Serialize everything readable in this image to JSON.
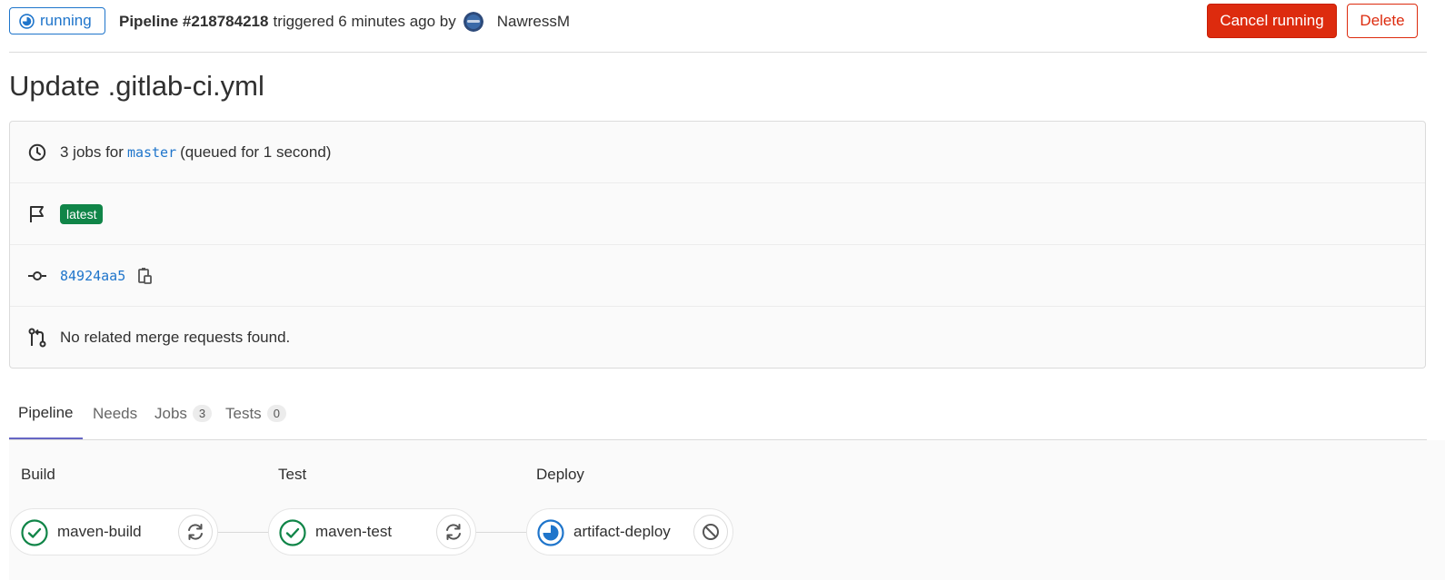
{
  "header": {
    "status_label": "running",
    "pipeline_id": "Pipeline #218784218",
    "triggered_text": "triggered 6 minutes ago by",
    "author": "NawressM",
    "cancel_label": "Cancel running",
    "delete_label": "Delete"
  },
  "title": "Update .gitlab-ci.yml",
  "info": {
    "jobs_prefix": "3 jobs for",
    "branch": "master",
    "queued": "(queued for 1 second)",
    "tag": "latest",
    "commit_sha": "84924aa5",
    "merge_requests": "No related merge requests found."
  },
  "tabs": [
    {
      "label": "Pipeline"
    },
    {
      "label": "Needs"
    },
    {
      "label": "Jobs",
      "count": "3"
    },
    {
      "label": "Tests",
      "count": "0"
    }
  ],
  "stages": [
    {
      "name": "Build",
      "job": "maven-build",
      "status": "success",
      "action": "retry-icon"
    },
    {
      "name": "Test",
      "job": "maven-test",
      "status": "success",
      "action": "retry-icon"
    },
    {
      "name": "Deploy",
      "job": "artifact-deploy",
      "status": "running",
      "action": "cancel-icon"
    }
  ],
  "colors": {
    "running": "#1f75cb",
    "success": "#108548",
    "danger": "#dd2b0e",
    "tab_active": "#6666c4"
  }
}
